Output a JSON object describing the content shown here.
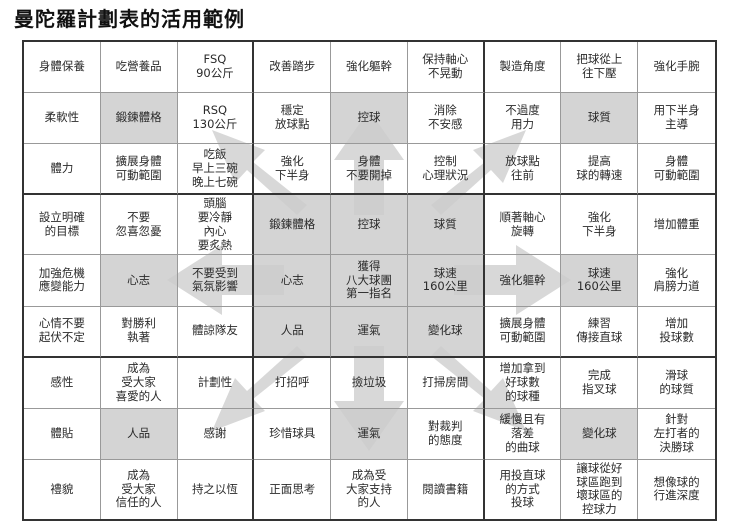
{
  "title": "曼陀羅計劃表的活用範例",
  "cells": [
    [
      "身體保養",
      "吃營養品",
      "FSQ\n90公斤",
      "改善踏步",
      "強化軀幹",
      "保持軸心\n不晃動",
      "製造角度",
      "把球從上\n往下壓",
      "強化手腕"
    ],
    [
      "柔軟性",
      "鍛鍊體格",
      "RSQ\n130公斤",
      "穩定\n放球點",
      "控球",
      "消除\n不安感",
      "不過度\n用力",
      "球質",
      "用下半身\n主導"
    ],
    [
      "體力",
      "擴展身體\n可動範圍",
      "吃飯\n早上三碗\n晚上七碗",
      "強化\n下半身",
      "身體\n不要開掉",
      "控制\n心理狀況",
      "放球點\n往前",
      "提高\n球的轉速",
      "身體\n可動範圍"
    ],
    [
      "設立明確\n的目標",
      "不要\n忽喜忽憂",
      "頭腦\n要冷靜\n內心\n要炙熱",
      "鍛鍊體格",
      "控球",
      "球質",
      "順著軸心\n旋轉",
      "強化\n下半身",
      "增加體重"
    ],
    [
      "加強危機\n應變能力",
      "心志",
      "不要受到\n氣氛影響",
      "心志",
      "獲得\n八大球團\n第一指名",
      "球速\n160公里",
      "強化軀幹",
      "球速\n160公里",
      "強化\n肩膀力道"
    ],
    [
      "心情不要\n起伏不定",
      "對勝利\n執著",
      "體諒隊友",
      "人品",
      "運氣",
      "變化球",
      "擴展身體\n可動範圍",
      "練習\n傳接直球",
      "增加\n投球數"
    ],
    [
      "感性",
      "成為\n受大家\n喜愛的人",
      "計劃性",
      "打招呼",
      "撿垃圾",
      "打掃房間",
      "增加拿到\n好球數\n的球種",
      "完成\n指叉球",
      "滑球\n的球質"
    ],
    [
      "體貼",
      "人品",
      "感謝",
      "珍惜球具",
      "運氣",
      "對裁判\n的態度",
      "緩慢且有\n落差\n的曲球",
      "變化球",
      "針對\n左打者的\n決勝球"
    ],
    [
      "禮貌",
      "成為\n受大家\n信任的人",
      "持之以恆",
      "正面思考",
      "成為受\n大家支持\n的人",
      "閱讀書籍",
      "用投直球\n的方式\n投球",
      "讓球從好\n球區跑到\n壞球區的\n控球力",
      "想像球的\n行進深度"
    ]
  ],
  "colors": {
    "shade": "#cdcdcd",
    "arrow": "#d4d4d4",
    "border": "#333333"
  }
}
